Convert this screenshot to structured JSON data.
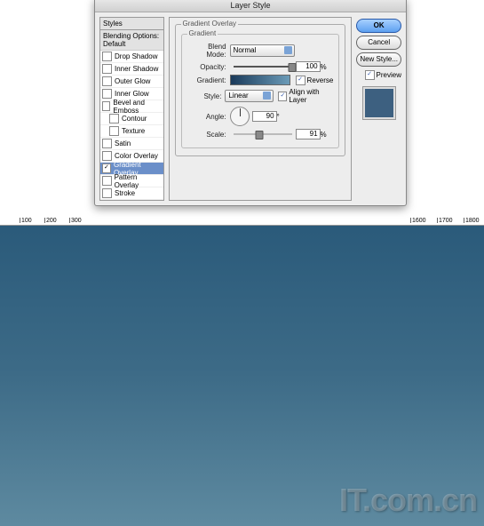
{
  "dialog_title": "Layer Style",
  "styles_header": "Styles",
  "blending_header": "Blending Options: Default",
  "styles": [
    {
      "label": "Drop Shadow",
      "checked": false,
      "indent": false
    },
    {
      "label": "Inner Shadow",
      "checked": false,
      "indent": false
    },
    {
      "label": "Outer Glow",
      "checked": false,
      "indent": false
    },
    {
      "label": "Inner Glow",
      "checked": false,
      "indent": false
    },
    {
      "label": "Bevel and Emboss",
      "checked": false,
      "indent": false
    },
    {
      "label": "Contour",
      "checked": false,
      "indent": true
    },
    {
      "label": "Texture",
      "checked": false,
      "indent": true
    },
    {
      "label": "Satin",
      "checked": false,
      "indent": false
    },
    {
      "label": "Color Overlay",
      "checked": false,
      "indent": false
    },
    {
      "label": "Gradient Overlay",
      "checked": true,
      "indent": false,
      "selected": true
    },
    {
      "label": "Pattern Overlay",
      "checked": false,
      "indent": false
    },
    {
      "label": "Stroke",
      "checked": false,
      "indent": false
    }
  ],
  "panel_title": "Gradient Overlay",
  "sub_title": "Gradient",
  "labels": {
    "blend": "Blend Mode:",
    "opacity": "Opacity:",
    "gradient": "Gradient:",
    "style": "Style:",
    "angle": "Angle:",
    "scale": "Scale:",
    "reverse": "Reverse",
    "align": "Align with Layer"
  },
  "values": {
    "blend_mode": "Normal",
    "opacity": "100",
    "opacity_pct": "%",
    "reverse": false,
    "style": "Linear",
    "align": true,
    "angle": "90",
    "angle_deg": "°",
    "scale": "91",
    "scale_pct": "%"
  },
  "gradient": {
    "start": "#1a3a5a",
    "end": "#6b9bb8"
  },
  "buttons": {
    "ok": "OK",
    "cancel": "Cancel",
    "newstyle": "New Style...",
    "preview": "Preview"
  },
  "preview_checked": true,
  "preview_color": "#3d6080",
  "ruler_ticks": [
    "100",
    "200",
    "300",
    "1600",
    "1700",
    "1800"
  ],
  "watermark": "IT.com.cn"
}
